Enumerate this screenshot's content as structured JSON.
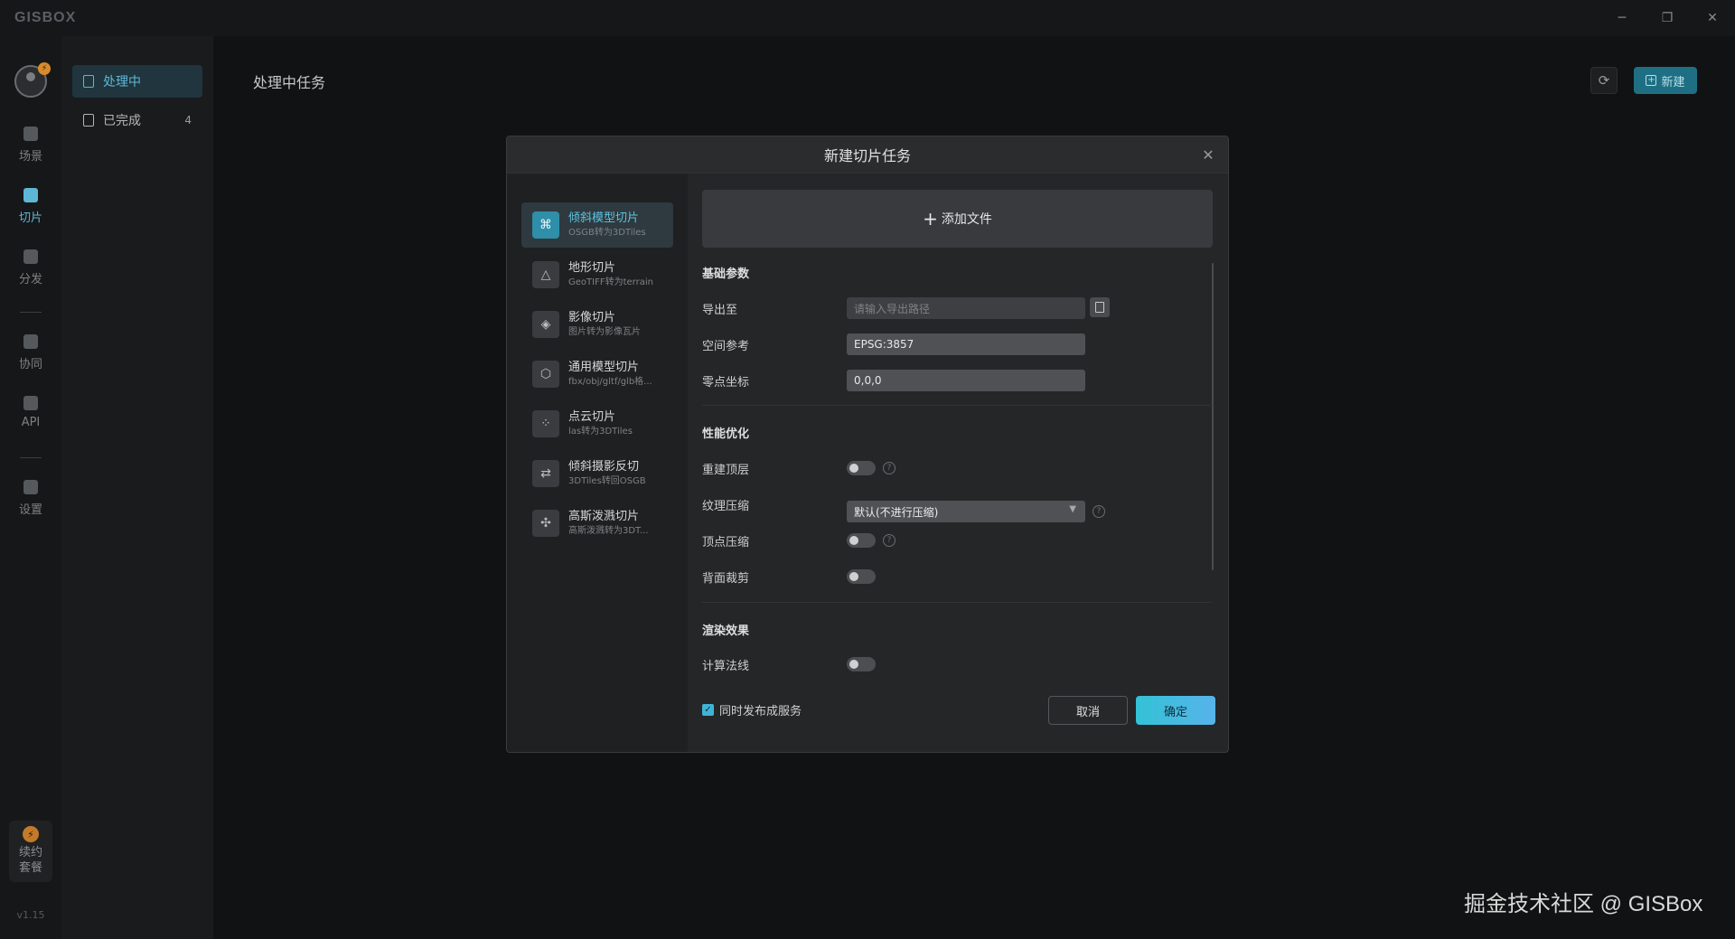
{
  "app": {
    "logo_text": "GISBOX",
    "version": "v1.15",
    "window_controls": [
      "minimize-icon",
      "restore-icon",
      "close-icon"
    ]
  },
  "rail": {
    "avatar_badge": "⚡",
    "items": [
      {
        "label": "场景",
        "icon": "scene-icon"
      },
      {
        "label": "切片",
        "icon": "tile-icon"
      },
      {
        "label": "分发",
        "icon": "share-icon"
      },
      {
        "label": "协同",
        "icon": "collab-icon"
      },
      {
        "label": "API",
        "icon": "api-icon"
      },
      {
        "label": "设置",
        "icon": "settings-icon"
      }
    ],
    "renew": {
      "line1": "续约",
      "line2": "套餐"
    }
  },
  "subnav": {
    "items": [
      {
        "label": "处理中",
        "count": ""
      },
      {
        "label": "已完成",
        "count": "4"
      }
    ]
  },
  "main": {
    "title": "处理中任务",
    "new_button": "新建"
  },
  "modal": {
    "title": "新建切片任务",
    "task_types": [
      {
        "name": "倾斜模型切片",
        "sub": "OSGB转为3DTiles",
        "icon": "oblique-model-icon"
      },
      {
        "name": "地形切片",
        "sub": "GeoTIFF转为terrain",
        "icon": "terrain-icon"
      },
      {
        "name": "影像切片",
        "sub": "图片转为影像瓦片",
        "icon": "imagery-icon"
      },
      {
        "name": "通用模型切片",
        "sub": "fbx/obj/gltf/glb格...",
        "icon": "cube-icon"
      },
      {
        "name": "点云切片",
        "sub": "las转为3DTiles",
        "icon": "pointcloud-icon"
      },
      {
        "name": "倾斜摄影反切",
        "sub": "3DTiles转回OSGB",
        "icon": "reverse-icon"
      },
      {
        "name": "高斯泼溅切片",
        "sub": "高斯泼溅转为3DT...",
        "icon": "gaussian-icon"
      }
    ],
    "add_file": "添加文件",
    "basic": {
      "title": "基础参数",
      "export_label": "导出至",
      "export_placeholder": "请输入导出路径",
      "srs_label": "空间参考",
      "srs_value": "EPSG:3857",
      "origin_label": "零点坐标",
      "origin_value": "0,0,0"
    },
    "perf": {
      "title": "性能优化",
      "rebuild_top": "重建顶层",
      "texture_compress": "纹理压缩",
      "texture_value": "默认(不进行压缩)",
      "vertex_compress": "顶点压缩",
      "backface_cull": "背面裁剪"
    },
    "render": {
      "title": "渲染效果",
      "normals": "计算法线"
    },
    "publish_label": "同时发布成服务",
    "publish_checked": true,
    "cancel": "取消",
    "ok": "确定"
  },
  "watermark": "掘金技术社区 @ GISBox"
}
